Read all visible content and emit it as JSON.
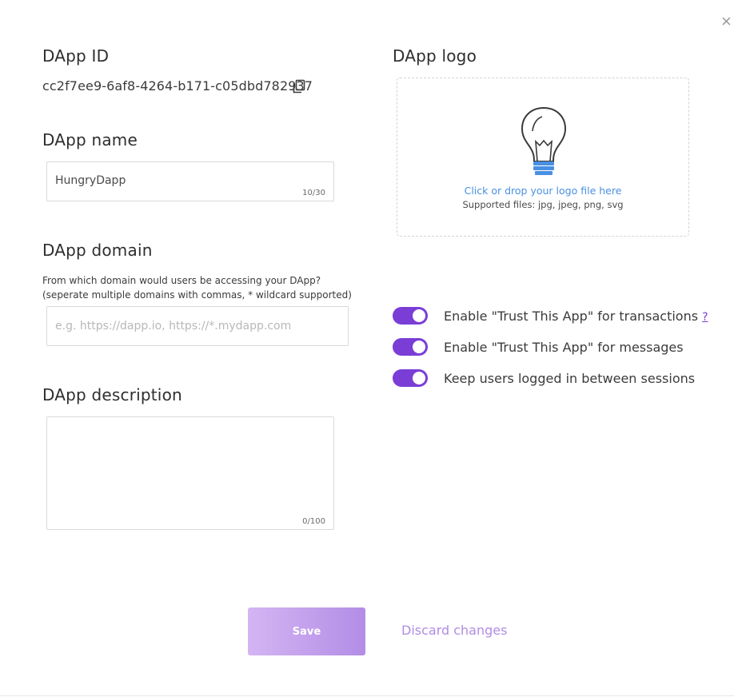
{
  "dialog": {
    "close_label": "×"
  },
  "dapp_id": {
    "heading": "DApp ID",
    "value": "cc2f7ee9-6af8-4264-b171-c05dbd782937",
    "copy_icon": "copy-icon"
  },
  "dapp_name": {
    "heading": "DApp name",
    "value": "HungryDapp",
    "counter": "10/30"
  },
  "dapp_domain": {
    "heading": "DApp domain",
    "help": "From which domain would users be accessing your DApp? (seperate multiple domains with commas, * wildcard supported)",
    "placeholder": "e.g. https://dapp.io, https://*.mydapp.com"
  },
  "dapp_description": {
    "heading": "DApp description",
    "value": "",
    "counter": "0/100"
  },
  "dapp_logo": {
    "heading": "DApp logo",
    "drop_link": "Click or drop your logo file here",
    "supported": "Supported files: jpg, jpeg, png, svg",
    "icon": "lightbulb-icon"
  },
  "toggles": [
    {
      "label": "Enable \"Trust This App\" for transactions",
      "on": true,
      "help": "?"
    },
    {
      "label": "Enable \"Trust This App\" for messages",
      "on": true
    },
    {
      "label": "Keep users logged in between sessions",
      "on": true
    }
  ],
  "actions": {
    "save_label": "Save",
    "discard_label": "Discard changes"
  },
  "colors": {
    "accent": "#7a3ed6",
    "link": "#4a90e2",
    "save_start": "#d4b5f3",
    "save_end": "#b38de6",
    "discard": "#b08de3"
  }
}
